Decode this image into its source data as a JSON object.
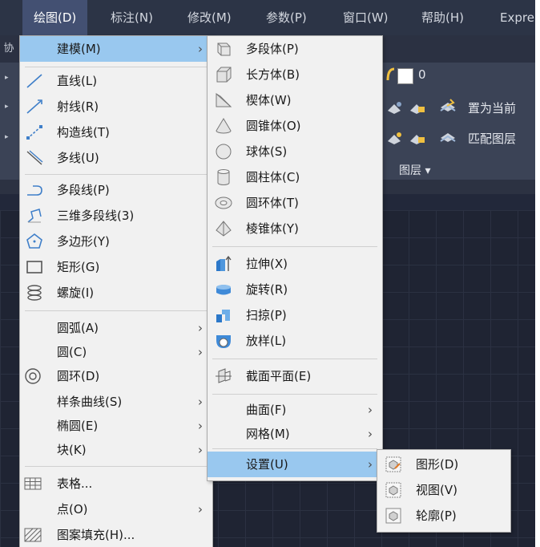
{
  "menubar": {
    "items": [
      {
        "label": "绘图(D)"
      },
      {
        "label": "标注(N)"
      },
      {
        "label": "修改(M)"
      },
      {
        "label": "参数(P)"
      },
      {
        "label": "窗口(W)"
      },
      {
        "label": "帮助(H)"
      },
      {
        "label": "Expre"
      }
    ]
  },
  "background": {
    "left_tab": "协",
    "layer_value": "0",
    "set_current": "置为当前",
    "match_layer": "匹配图层",
    "layer_panel": "图层 ▾"
  },
  "draw_menu": {
    "items": [
      {
        "label": "建模(M)",
        "arrow": "›"
      },
      {
        "label": "直线(L)"
      },
      {
        "label": "射线(R)"
      },
      {
        "label": "构造线(T)"
      },
      {
        "label": "多线(U)"
      },
      {
        "label": "多段线(P)"
      },
      {
        "label": "三维多段线(3)"
      },
      {
        "label": "多边形(Y)"
      },
      {
        "label": "矩形(G)"
      },
      {
        "label": "螺旋(I)"
      },
      {
        "label": "圆弧(A)",
        "arrow": "›"
      },
      {
        "label": "圆(C)",
        "arrow": "›"
      },
      {
        "label": "圆环(D)"
      },
      {
        "label": "样条曲线(S)",
        "arrow": "›"
      },
      {
        "label": "椭圆(E)",
        "arrow": "›"
      },
      {
        "label": "块(K)",
        "arrow": "›"
      },
      {
        "label": "表格..."
      },
      {
        "label": "点(O)",
        "arrow": "›"
      },
      {
        "label": "图案填充(H)..."
      }
    ]
  },
  "modeling_menu": {
    "items": [
      {
        "label": "多段体(P)"
      },
      {
        "label": "长方体(B)"
      },
      {
        "label": "楔体(W)"
      },
      {
        "label": "圆锥体(O)"
      },
      {
        "label": "球体(S)"
      },
      {
        "label": "圆柱体(C)"
      },
      {
        "label": "圆环体(T)"
      },
      {
        "label": "棱锥体(Y)"
      },
      {
        "label": "拉伸(X)"
      },
      {
        "label": "旋转(R)"
      },
      {
        "label": "扫掠(P)"
      },
      {
        "label": "放样(L)"
      },
      {
        "label": "截面平面(E)"
      },
      {
        "label": "曲面(F)",
        "arrow": "›"
      },
      {
        "label": "网格(M)",
        "arrow": "›"
      },
      {
        "label": "设置(U)",
        "arrow": "›"
      }
    ]
  },
  "setup_menu": {
    "items": [
      {
        "label": "图形(D)"
      },
      {
        "label": "视图(V)"
      },
      {
        "label": "轮廓(P)"
      }
    ]
  },
  "colors": {
    "highlight": "#99c8ef",
    "menu_bg": "#f1f1f1",
    "app_bg": "#22283a",
    "menubar_active": "#435072"
  }
}
